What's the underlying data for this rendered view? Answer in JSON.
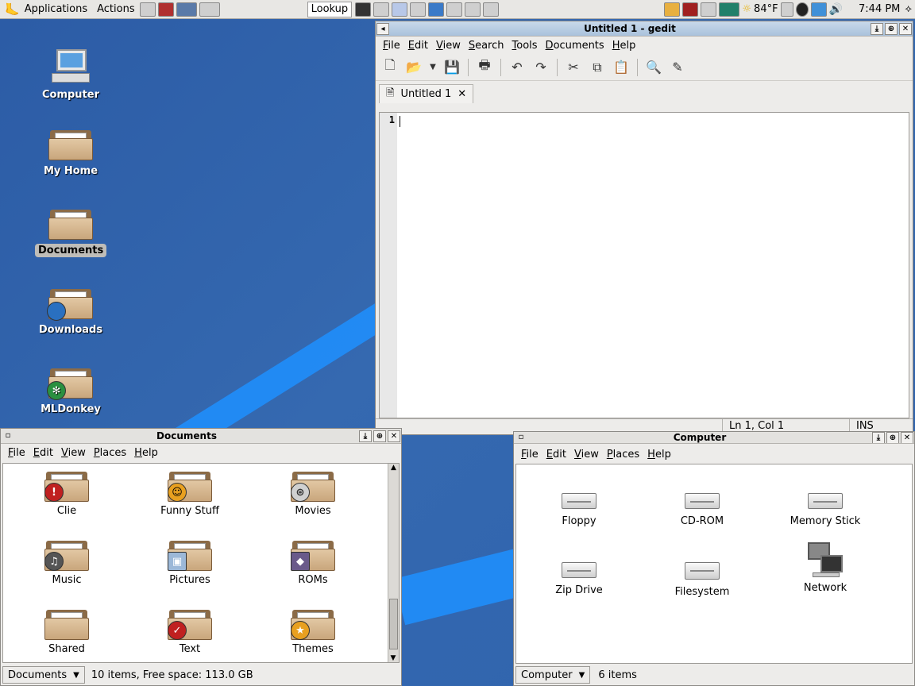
{
  "panel": {
    "applications": "Applications",
    "actions": "Actions",
    "lookup": "Lookup",
    "weather": "84°F",
    "clock": "7:44 PM"
  },
  "desktop": {
    "icons": [
      {
        "label": "Computer"
      },
      {
        "label": "My Home"
      },
      {
        "label": "Documents"
      },
      {
        "label": "Downloads"
      },
      {
        "label": "MLDonkey"
      }
    ]
  },
  "gedit": {
    "title": "Untitled 1 - gedit",
    "menu": [
      "File",
      "Edit",
      "View",
      "Search",
      "Tools",
      "Documents",
      "Help"
    ],
    "tab": "Untitled 1",
    "line_number": "1",
    "position": "Ln 1, Col 1",
    "mode": "INS"
  },
  "documents_window": {
    "title": "Documents",
    "menu": [
      "File",
      "Edit",
      "View",
      "Places",
      "Help"
    ],
    "items": [
      "Clie",
      "Funny Stuff",
      "Movies",
      "Music",
      "Pictures",
      "ROMs",
      "Shared",
      "Text",
      "Themes"
    ],
    "location": "Documents",
    "status": "10 items, Free space: 113.0 GB"
  },
  "computer_window": {
    "title": "Computer",
    "menu": [
      "File",
      "Edit",
      "View",
      "Places",
      "Help"
    ],
    "items": [
      "Floppy",
      "CD-ROM",
      "Memory Stick",
      "Zip Drive",
      "Filesystem",
      "Network"
    ],
    "location": "Computer",
    "status": "6 items"
  }
}
